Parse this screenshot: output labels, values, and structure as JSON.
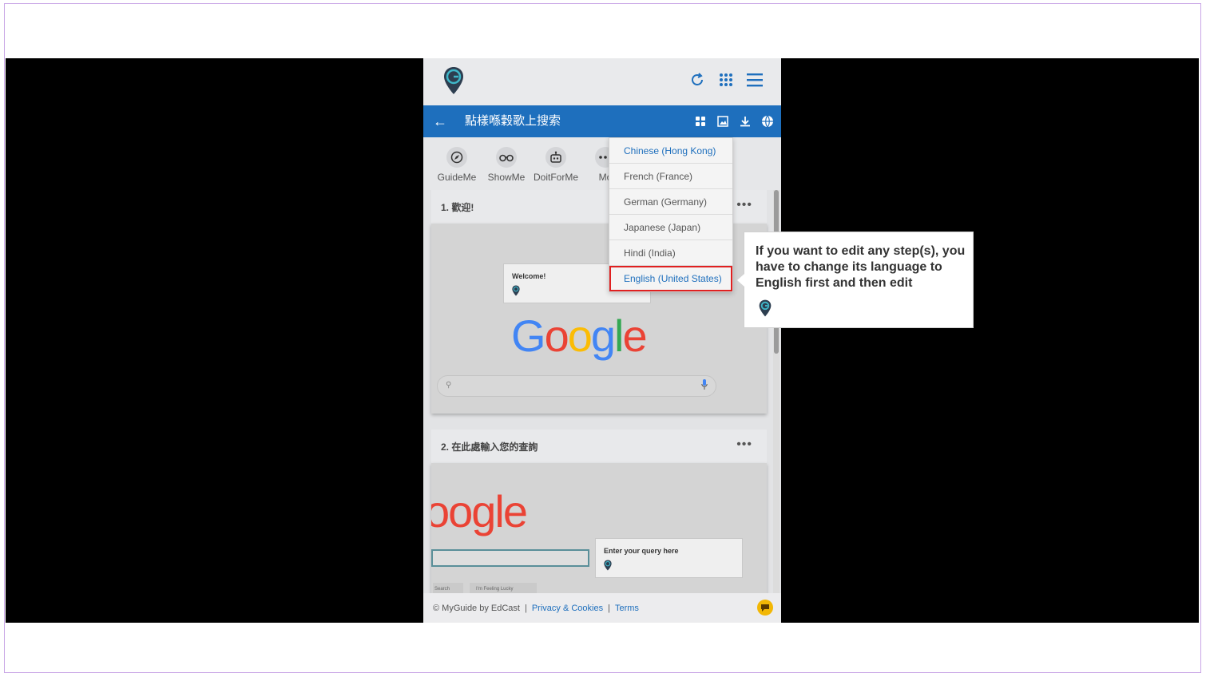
{
  "header": {
    "logo_icon": "myguide-pin-icon",
    "icons": [
      "refresh-icon",
      "apps-grid-icon",
      "hamburger-menu-icon"
    ]
  },
  "guide": {
    "title": "點樣喺穀歌上搜索",
    "back_icon": "arrow-left-icon",
    "tools": [
      "grid-view-icon",
      "image-icon",
      "download-icon",
      "language-globe-icon"
    ]
  },
  "modes": [
    {
      "label": "GuideMe",
      "icon": "compass-icon"
    },
    {
      "label": "ShowMe",
      "icon": "binoculars-icon"
    },
    {
      "label": "DoItForMe",
      "icon": "robot-icon"
    },
    {
      "label": "More",
      "icon": "more-icon"
    }
  ],
  "steps": [
    {
      "title": "1. 歡迎!",
      "tip_text": "Welcome!",
      "logo_text": "Google"
    },
    {
      "title": "2. 在此處輸入您的查詢",
      "tip_text": "Enter your query here",
      "logo_text": "oogle",
      "btn1": "Search",
      "btn2": "I'm Feeling Lucky"
    }
  ],
  "language_menu": {
    "items": [
      "Chinese (Hong Kong)",
      "French (France)",
      "German (Germany)",
      "Japanese (Japan)",
      "Hindi (India)",
      "English (United States)"
    ],
    "active": "Chinese (Hong Kong)",
    "highlighted": "English (United States)"
  },
  "callout": {
    "text": "If you want to edit any step(s), you have to change its language to English first and then edit"
  },
  "footer": {
    "copyright": "© MyGuide by EdCast",
    "privacy": "Privacy & Cookies",
    "terms": "Terms",
    "separator": "|"
  },
  "colors": {
    "accent": "#1e6fbd",
    "highlight_border": "#e02020",
    "chat_button": "#f2b705"
  }
}
